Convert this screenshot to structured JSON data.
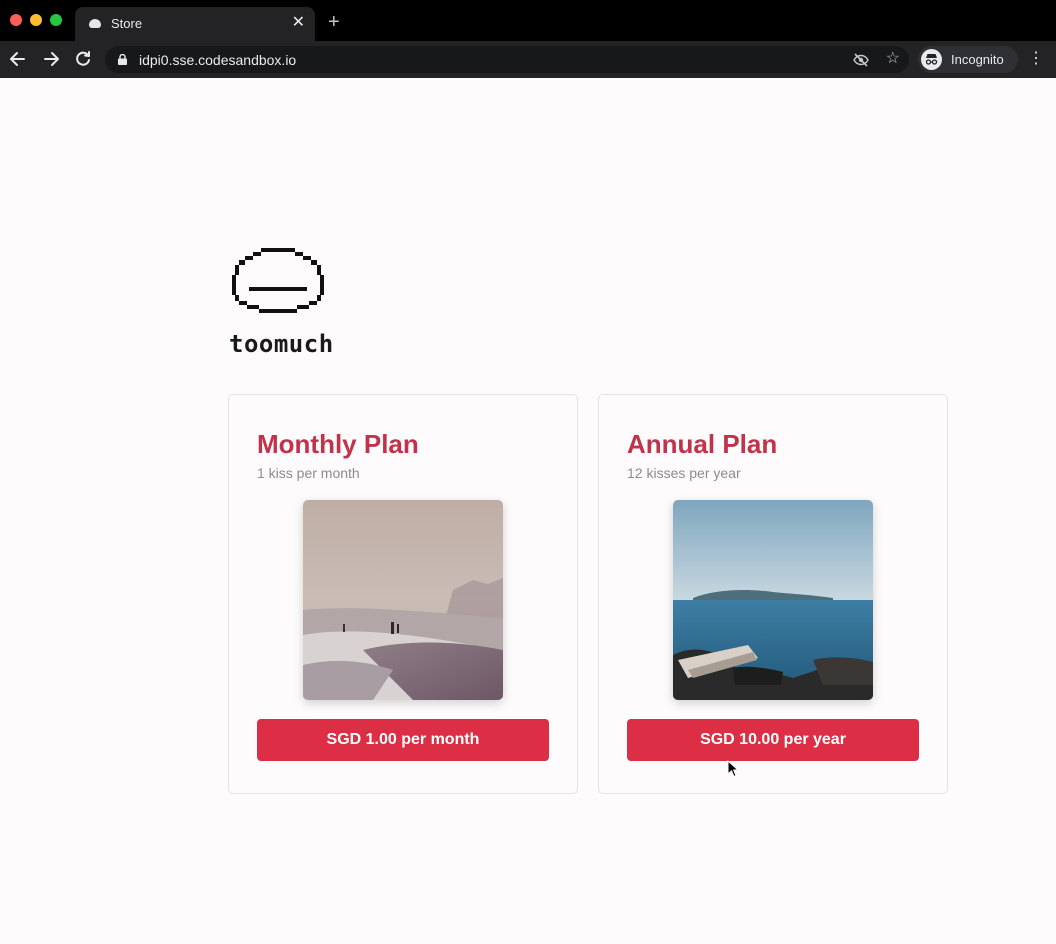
{
  "browser": {
    "tab_title": "Store",
    "tab_close": "✕",
    "new_tab": "+",
    "url": "idpi0.sse.codesandbox.io",
    "profile_label": "Incognito",
    "icons": {
      "back": "arrow-left-icon",
      "forward": "arrow-right-icon",
      "reload": "reload-icon",
      "lock": "lock-icon",
      "tracking": "eye-slash-icon",
      "bookmark": "star-icon",
      "menu": "kebab-menu-icon"
    }
  },
  "brand": {
    "name": "toomuch",
    "logo": "pixel-face-logo"
  },
  "plans": [
    {
      "title": "Monthly Plan",
      "subtitle": "1 kiss per month",
      "button_label": "SGD 1.00 per month",
      "photo": "hazy beach with people in the surf"
    },
    {
      "title": "Annual Plan",
      "subtitle": "12 kisses per year",
      "button_label": "SGD 10.00 per year",
      "photo": "blue sea with rocks and driftwood"
    }
  ],
  "colors": {
    "accent": "#dc2f45",
    "title": "#c0334a",
    "subtitle": "#8c8c8c",
    "page_bg": "#fdfbfb"
  }
}
